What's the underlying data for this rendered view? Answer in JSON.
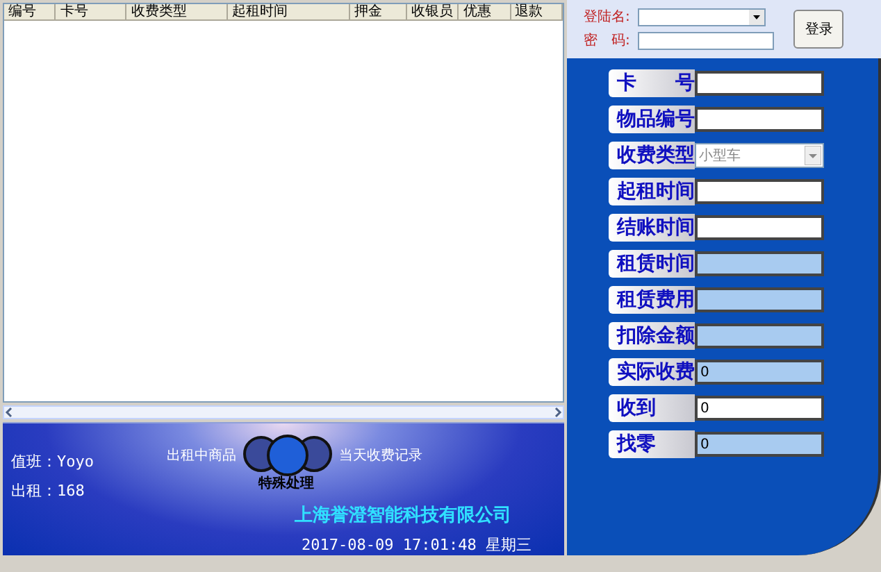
{
  "table": {
    "columns": [
      "编号",
      "卡号",
      "收费类型",
      "起租时间",
      "押金",
      "收银员",
      "优惠",
      "退款"
    ]
  },
  "status": {
    "duty": "值班：Yoyo",
    "rented": "出租：168"
  },
  "nav": {
    "left": "出租中商品",
    "right": "当天收费记录",
    "center": "特殊处理"
  },
  "company": "上海誉澄智能科技有限公司",
  "datetime": "2017-08-09 17:01:48 星期三",
  "login": {
    "user_label": "登陆名:",
    "password_label": "密　码:",
    "button": "登录"
  },
  "form": [
    {
      "label": "卡　　号",
      "kind": "text"
    },
    {
      "label": "物品编号",
      "kind": "text"
    },
    {
      "label": "收费类型",
      "kind": "select",
      "value": "小型车"
    },
    {
      "label": "起租时间",
      "kind": "text"
    },
    {
      "label": "结账时间",
      "kind": "text"
    },
    {
      "label": "租赁时间",
      "kind": "readonly"
    },
    {
      "label": "租赁费用",
      "kind": "readonly"
    },
    {
      "label": "扣除金额",
      "kind": "readonly"
    },
    {
      "label": "实际收费",
      "kind": "readonly",
      "value": "0"
    },
    {
      "label": "收到",
      "kind": "text",
      "value": "0"
    },
    {
      "label": "找零",
      "kind": "readonly",
      "value": "0"
    }
  ]
}
